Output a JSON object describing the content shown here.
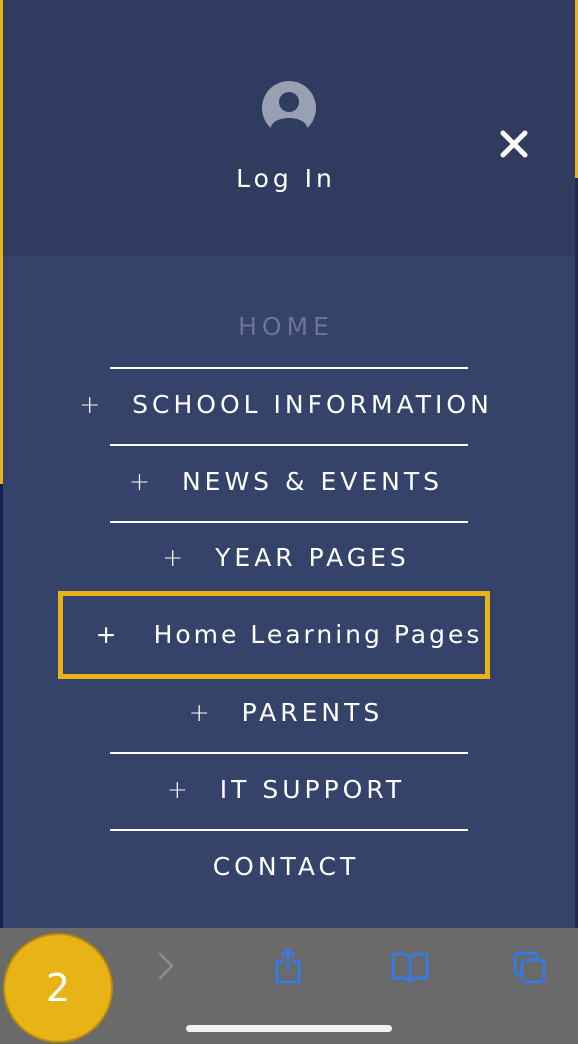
{
  "header": {
    "login_label": "Log In",
    "close_icon": "close-icon",
    "avatar_icon": "user-avatar-icon"
  },
  "menu": {
    "items": [
      {
        "label": "HOME",
        "has_expand": false,
        "active": true
      },
      {
        "label": "SCHOOL INFORMATION",
        "has_expand": true
      },
      {
        "label": "NEWS & EVENTS",
        "has_expand": true
      },
      {
        "label": "YEAR PAGES",
        "has_expand": true
      },
      {
        "label": "Home Learning Pages",
        "has_expand": true,
        "highlighted": true
      },
      {
        "label": "PARENTS",
        "has_expand": true
      },
      {
        "label": "IT SUPPORT",
        "has_expand": true
      },
      {
        "label": "CONTACT",
        "has_expand": false
      }
    ],
    "expand_symbol": "+"
  },
  "toolbar": {
    "icons": [
      "forward-chevron-icon",
      "share-icon",
      "bookmarks-icon",
      "tabs-icon"
    ]
  },
  "annotation": {
    "step_number": "2"
  },
  "colors": {
    "header_bg": "#2f3b5f",
    "menu_bg": "#35426a",
    "accent": "#e8b317",
    "toolbar_bg": "#6a6a6a",
    "ios_blue": "#2f7cf6",
    "home_inactive_text": "#6a7596"
  }
}
